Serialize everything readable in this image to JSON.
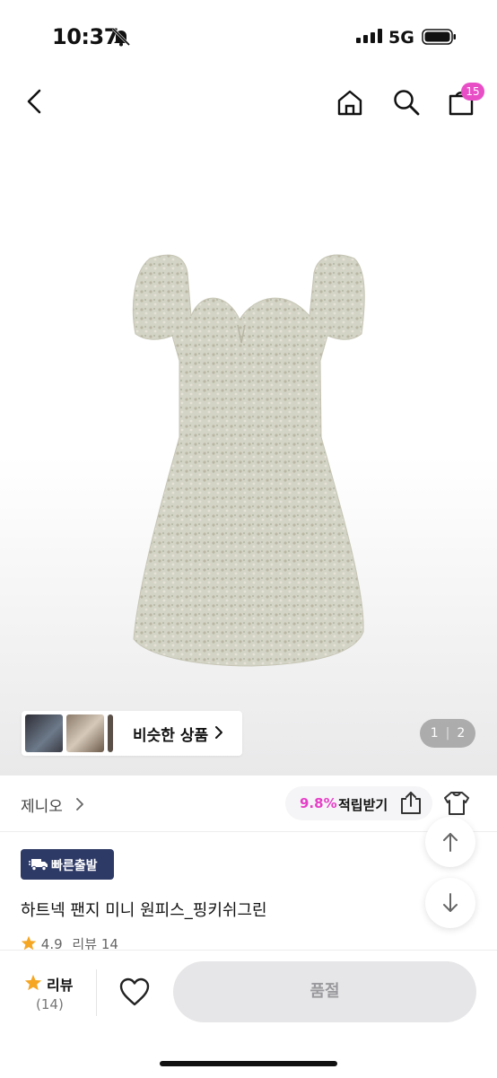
{
  "status_bar": {
    "time": "10:37",
    "network": "5G"
  },
  "nav": {
    "cart_count": "15"
  },
  "gallery": {
    "similar_label": "비슷한 상품",
    "pager_current": "1",
    "pager_total": "2"
  },
  "brand": {
    "name": "제니오"
  },
  "points": {
    "percent": "9.8%",
    "label": "적립받기"
  },
  "product": {
    "badge": "빠른출발",
    "title": "하트넥 팬지 미니 원피스_핑키쉬그린",
    "rating": "4.9",
    "review_label": "리뷰",
    "review_count": "14"
  },
  "bottom_bar": {
    "review_label": "리뷰",
    "review_count": "(14)",
    "cta_label": "품절"
  },
  "colors": {
    "accent": "#e84fc6",
    "badge_bg": "#2e3a66",
    "star": "#f5a623"
  },
  "icons": [
    "back-icon",
    "home-icon",
    "search-icon",
    "bag-icon",
    "chevron-right-icon",
    "share-icon",
    "wardrobe-icon",
    "truck-icon",
    "arrow-up-icon",
    "arrow-down-icon",
    "star-icon",
    "heart-icon",
    "bell-off-icon"
  ]
}
